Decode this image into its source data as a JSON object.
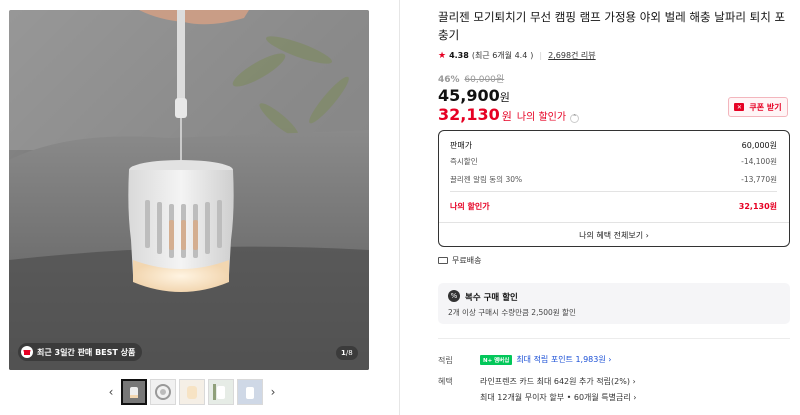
{
  "gallery": {
    "badge_text": "최근 3일간 판매 BEST 상품",
    "page_current": "1",
    "page_total": "/8",
    "prev_arrow": "‹",
    "next_arrow": "›"
  },
  "product": {
    "title": "끌리젠 모기퇴치기 무선 캠핑 램프 가정용 야외 벌레 해충 날파리 퇴치 포충기",
    "rating_score": "4.38",
    "rating_recent": "(최근 6개월 4.4",
    "rating_recent_close": ")",
    "review_count": "2,698건 리뷰",
    "discount_pct": "46%",
    "original_price": "60,000원",
    "price": "45,900",
    "price_unit": "원",
    "my_price": "32,130",
    "my_price_unit": "원",
    "my_price_label": "나의 할인가",
    "coupon_label": "쿠폰 받기"
  },
  "price_box": {
    "rows": [
      {
        "label": "판매가",
        "value": "60,000원"
      },
      {
        "label": "즉시할인",
        "value": "-14,100원"
      },
      {
        "label": "끌리젠 알림 동의 30%",
        "value": "-13,770원"
      }
    ],
    "my_label": "나의 할인가",
    "my_value": "32,130원",
    "view_all": "나의 혜택 전체보기 ›"
  },
  "shipping": {
    "label": "무료배송"
  },
  "multi_buy": {
    "title": "복수 구매 할인",
    "icon_text": "%",
    "desc": "2개 이상 구매시 수량만큼 2,500원 할인"
  },
  "benefits": {
    "points_label": "적립",
    "npay_badge": "N+ 멤버십",
    "points_text": "최대 적립 포인트 1,983원 ›",
    "benefit_label": "혜택",
    "benefit_line1": "라인프렌즈 카드 최대 642원 추가 적립(2%) ›",
    "benefit_line2": "최대 12개월 무이자 할부 • 60개월 특별금리 ›"
  },
  "colors": {
    "accent_red": "#e60023",
    "npay_green": "#03c75a",
    "link_blue": "#1a4fd6"
  }
}
